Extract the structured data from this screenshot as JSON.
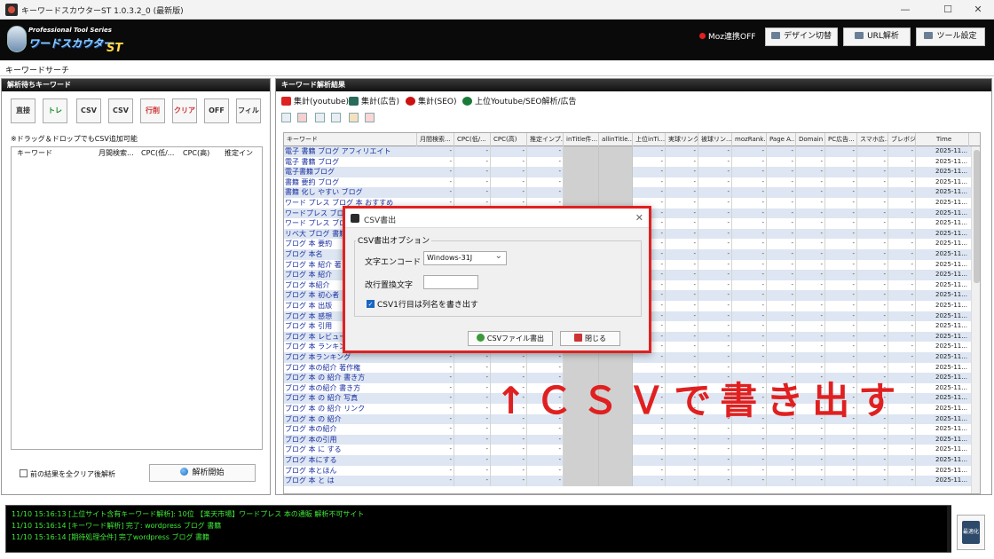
{
  "window": {
    "title": "キーワードスカウターST 1.0.3.2_0 (最新版)",
    "min": "—",
    "max": "☐",
    "close": "✕"
  },
  "header": {
    "logo_sub": "Professional Tool Series",
    "logo_main": "ワードスカウター",
    "logo_st": "ST",
    "moz_status": "Moz連携OFF",
    "buttons": [
      "デザイン切替",
      "URL解析",
      "ツール設定"
    ]
  },
  "menu": {
    "search": "キーワードサーチ"
  },
  "left_panel": {
    "title": "解析待ちキーワード",
    "tools": [
      "直接",
      "トレ",
      "CSV",
      "CSV",
      "行削",
      "クリア",
      "OFF",
      "フィル"
    ],
    "drag_note": "※ドラッグ＆ドロップでもCSV追加可能",
    "columns": [
      "キーワード",
      "月間検索...",
      "CPC(低/...",
      "CPC(高)",
      "推定インプ..."
    ],
    "clear_check": "前の結果を全クリア後解析",
    "analyze_button": "解析開始"
  },
  "right_panel": {
    "title": "キーワード解析結果",
    "tabs": [
      "集計(youtube)",
      "集計(広告)",
      "集計(SEO)",
      "上位Youtube/SEO解析/広告"
    ],
    "columns": [
      "キーワード",
      "月間検索...",
      "CPC(低/...",
      "CPC(高)",
      "推定インプ...",
      "inTitle件...",
      "allinTitle...",
      "上位inTi...",
      "実球リンク...",
      "被球リン...",
      "mozRank...",
      "Page A...",
      "Domain ...",
      "PC広告...",
      "スマホ広...",
      "ブレボジ...",
      "Time"
    ],
    "dash": "-",
    "time_value": "2025-11...",
    "keywords": [
      "電子 書籍 ブログ アフィリエイト",
      "電子 書籍 ブログ",
      "電子書籍ブログ",
      "書籍 要約 ブログ",
      "書籍 化し やすい ブログ",
      "ワード プレス ブログ 本 おすすめ",
      "ワードプレス ブログ",
      "ワード プレス ブログ",
      "リベ大 ブログ 書籍",
      "ブログ 本 要約",
      "ブログ 本名",
      "ブログ 本 紹介 著",
      "ブログ 本 紹介",
      "ブログ 本紹介",
      "ブログ 本 初心者",
      "ブログ 本 出版",
      "ブログ 本 感想",
      "ブログ 本 引用",
      "ブログ 本 レビュー",
      "ブログ 本 ランキング",
      "ブログ 本ランキング",
      "ブログ 本の紹介 著作権",
      "ブログ 本 の 紹介 書き方",
      "ブログ 本の紹介 書き方",
      "ブログ 本 の 紹介 写真",
      "ブログ 本 の 紹介 リンク",
      "ブログ 本 の 紹介",
      "ブログ 本の紹介",
      "ブログ 本の引用",
      "ブログ 本 に する",
      "ブログ 本にする",
      "ブログ 本とほん",
      "ブログ 本 と は"
    ],
    "icon_row": [
      "tool-a",
      "tool-b",
      "tool-c",
      "tool-d",
      "tool-e",
      "csv"
    ]
  },
  "annotation": "↑ＣＳＶで書き出す",
  "dialog": {
    "title": "CSV書出",
    "close": "✕",
    "group_label": "CSV書出オプション",
    "encoding_label": "文字エンコード",
    "encoding_value": "Windows-31J",
    "replace_label": "改行置換文字",
    "replace_value": "",
    "header_check": "CSV1行目は列名を書き出す",
    "export_button": "CSVファイル書出",
    "close_button": "閉じる"
  },
  "log": [
    "11/10 15:16:13 [上位サイト含有キーワード解析]: 10位 【楽天市場】ワードプレス 本の通販 解析不可サイト",
    "11/10 15:16:14 [キーワード解析] 完了: wordpress ブログ 書籍",
    "11/10 15:16:14 [期待処理全件] 完了wordpress ブログ 書籍"
  ],
  "side_button": "最適化",
  "colors": {
    "accent_red": "#e02020",
    "log_green": "#3ee836",
    "link_blue": "#1a2fa0"
  }
}
